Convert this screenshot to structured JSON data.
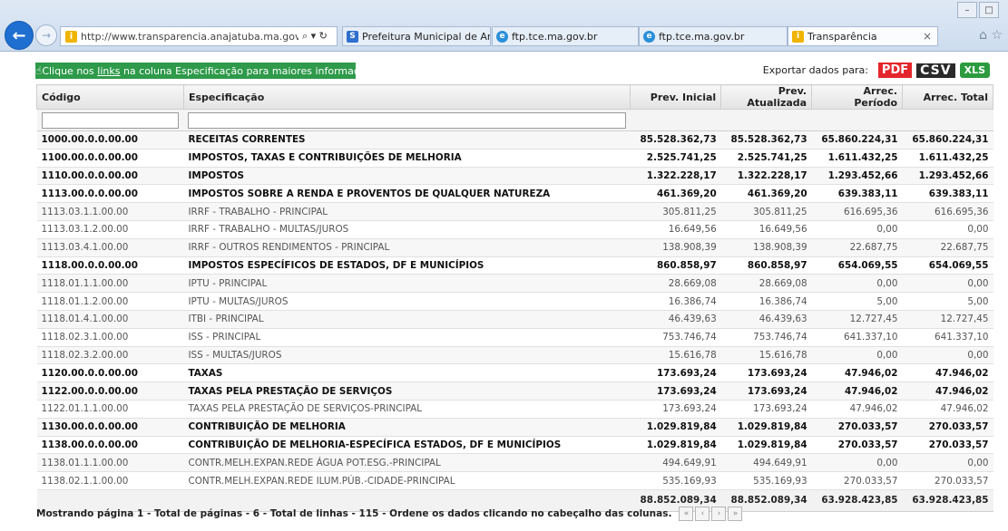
{
  "browser": {
    "url": "http://www.transparencia.anajatuba.ma.gov.br/acesso",
    "url_controls": "⌕ ▾ ↻",
    "tabs": [
      {
        "label": "Prefeitura Municipal de Anajat...",
        "icon": "S"
      },
      {
        "label": "ftp.tce.ma.gov.br",
        "icon": "e"
      },
      {
        "label": "ftp.tce.ma.gov.br",
        "icon": "e"
      },
      {
        "label": "Transparência",
        "icon": "i",
        "close": "×"
      }
    ],
    "window_controls": [
      "–",
      "□"
    ],
    "tools": "⌂ ☆"
  },
  "info": {
    "prefix": "Clique nos ",
    "link": "links",
    "suffix": " na coluna Especificação para maiores informações."
  },
  "export": {
    "label": "Exportar dados para:",
    "pdf": "PDF",
    "csv": "CSV",
    "xls": "XLS"
  },
  "table": {
    "headers": [
      "Código",
      "Especificação",
      "Prev. Inicial",
      "Prev. Atualizada",
      "Arrec. Período",
      "Arrec. Total"
    ],
    "rows": [
      {
        "bold": true,
        "cells": [
          "1000.00.0.0.00.00",
          "RECEITAS CORRENTES",
          "85.528.362,73",
          "85.528.362,73",
          "65.860.224,31",
          "65.860.224,31"
        ]
      },
      {
        "bold": true,
        "cells": [
          "1100.00.0.0.00.00",
          "IMPOSTOS, TAXAS E CONTRIBUIÇÕES DE MELHORIA",
          "2.525.741,25",
          "2.525.741,25",
          "1.611.432,25",
          "1.611.432,25"
        ]
      },
      {
        "bold": true,
        "cells": [
          "1110.00.0.0.00.00",
          "IMPOSTOS",
          "1.322.228,17",
          "1.322.228,17",
          "1.293.452,66",
          "1.293.452,66"
        ]
      },
      {
        "bold": true,
        "cells": [
          "1113.00.0.0.00.00",
          "IMPOSTOS SOBRE A RENDA E PROVENTOS DE QUALQUER NATUREZA",
          "461.369,20",
          "461.369,20",
          "639.383,11",
          "639.383,11"
        ]
      },
      {
        "bold": false,
        "cells": [
          "1113.03.1.1.00.00",
          "IRRF - TRABALHO - PRINCIPAL",
          "305.811,25",
          "305.811,25",
          "616.695,36",
          "616.695,36"
        ]
      },
      {
        "bold": false,
        "cells": [
          "1113.03.1.2.00.00",
          "IRRF - TRABALHO - MULTAS/JUROS",
          "16.649,56",
          "16.649,56",
          "0,00",
          "0,00"
        ]
      },
      {
        "bold": false,
        "cells": [
          "1113.03.4.1.00.00",
          "IRRF - OUTROS RENDIMENTOS - PRINCIPAL",
          "138.908,39",
          "138.908,39",
          "22.687,75",
          "22.687,75"
        ]
      },
      {
        "bold": true,
        "cells": [
          "1118.00.0.0.00.00",
          "IMPOSTOS ESPECÍFICOS DE ESTADOS, DF E MUNICÍPIOS",
          "860.858,97",
          "860.858,97",
          "654.069,55",
          "654.069,55"
        ]
      },
      {
        "bold": false,
        "cells": [
          "1118.01.1.1.00.00",
          "IPTU - PRINCIPAL",
          "28.669,08",
          "28.669,08",
          "0,00",
          "0,00"
        ]
      },
      {
        "bold": false,
        "cells": [
          "1118.01.1.2.00.00",
          "IPTU - MULTAS/JUROS",
          "16.386,74",
          "16.386,74",
          "5,00",
          "5,00"
        ]
      },
      {
        "bold": false,
        "cells": [
          "1118.01.4.1.00.00",
          "ITBI - PRINCIPAL",
          "46.439,63",
          "46.439,63",
          "12.727,45",
          "12.727,45"
        ]
      },
      {
        "bold": false,
        "cells": [
          "1118.02.3.1.00.00",
          "ISS - PRINCIPAL",
          "753.746,74",
          "753.746,74",
          "641.337,10",
          "641.337,10"
        ]
      },
      {
        "bold": false,
        "cells": [
          "1118.02.3.2.00.00",
          "ISS - MULTAS/JUROS",
          "15.616,78",
          "15.616,78",
          "0,00",
          "0,00"
        ]
      },
      {
        "bold": true,
        "cells": [
          "1120.00.0.0.00.00",
          "TAXAS",
          "173.693,24",
          "173.693,24",
          "47.946,02",
          "47.946,02"
        ]
      },
      {
        "bold": true,
        "cells": [
          "1122.00.0.0.00.00",
          "TAXAS PELA PRESTAÇÃO DE SERVIÇOS",
          "173.693,24",
          "173.693,24",
          "47.946,02",
          "47.946,02"
        ]
      },
      {
        "bold": false,
        "cells": [
          "1122.01.1.1.00.00",
          "TAXAS PELA PRESTAÇÃO DE SERVIÇOS-PRINCIPAL",
          "173.693,24",
          "173.693,24",
          "47.946,02",
          "47.946,02"
        ]
      },
      {
        "bold": true,
        "cells": [
          "1130.00.0.0.00.00",
          "CONTRIBUIÇÃO DE MELHORIA",
          "1.029.819,84",
          "1.029.819,84",
          "270.033,57",
          "270.033,57"
        ]
      },
      {
        "bold": true,
        "cells": [
          "1138.00.0.0.00.00",
          "CONTRIBUIÇÃO DE MELHORIA-ESPECÍFICA ESTADOS, DF E MUNICÍPIOS",
          "1.029.819,84",
          "1.029.819,84",
          "270.033,57",
          "270.033,57"
        ]
      },
      {
        "bold": false,
        "cells": [
          "1138.01.1.1.00.00",
          "CONTR.MELH.EXPAN.REDE ÁGUA POT.ESG.-PRINCIPAL",
          "494.649,91",
          "494.649,91",
          "0,00",
          "0,00"
        ]
      },
      {
        "bold": false,
        "cells": [
          "1138.02.1.1.00.00",
          "CONTR.MELH.EXPAN.REDE ILUM.PÚB.-CIDADE-PRINCIPAL",
          "535.169,93",
          "535.169,93",
          "270.033,57",
          "270.033,57"
        ]
      }
    ],
    "totals": [
      "",
      "",
      "88.852.089,34",
      "88.852.089,34",
      "63.928.423,85",
      "63.928.423,85"
    ]
  },
  "footer": {
    "text": "Mostrando página 1 - Total de páginas - 6 - Total de linhas - 115 - Ordene os dados clicando no cabeçalho das colunas.",
    "pager": [
      "«",
      "‹",
      "›",
      "»"
    ]
  }
}
